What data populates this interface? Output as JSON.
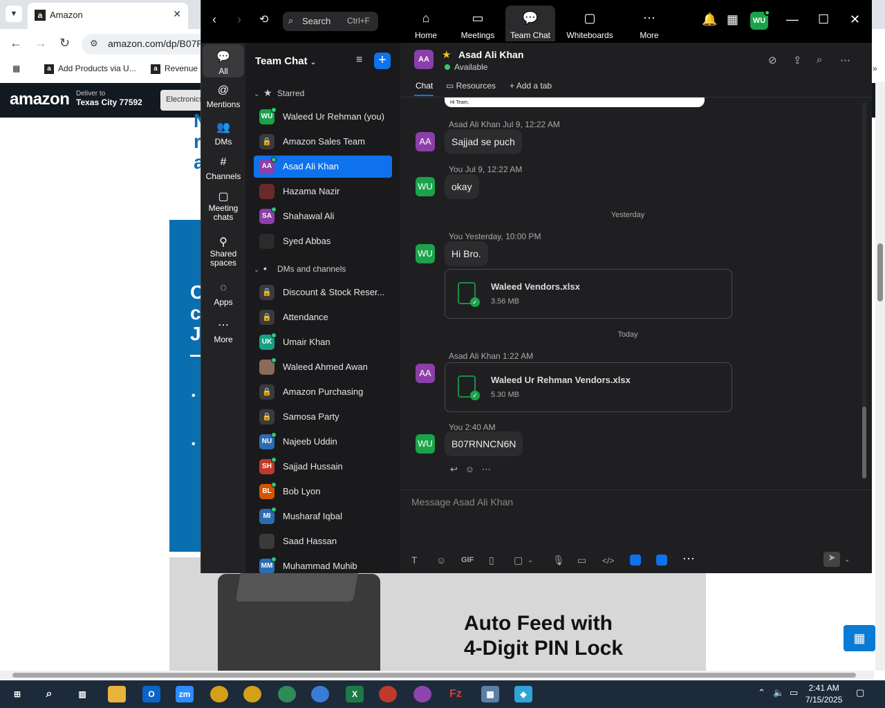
{
  "browser": {
    "tab_title": "Amazon",
    "url": "amazon.com/dp/B07R",
    "bookmarks": [
      "Add Products via U...",
      "Revenue"
    ],
    "amazon": {
      "logo": "amazon",
      "deliver_to": "Deliver to",
      "location": "Texas City 77592",
      "search_category": "Electronics"
    },
    "product_blurb_letters": [
      "N",
      "r",
      "a"
    ],
    "banner_letters": [
      "C",
      "c",
      "J",
      "—",
      "•",
      "•"
    ],
    "autofeed_line1": "Auto Feed with",
    "autofeed_line2": "4-Digit PIN Lock"
  },
  "zoom": {
    "search": {
      "label": "Search",
      "shortcut": "Ctrl+F"
    },
    "top_tabs": [
      {
        "label": "Home",
        "icon": "home-icon"
      },
      {
        "label": "Meetings",
        "icon": "video-icon"
      },
      {
        "label": "Team Chat",
        "icon": "chat-icon",
        "active": true
      },
      {
        "label": "Whiteboards",
        "icon": "whiteboard-icon"
      },
      {
        "label": "More",
        "icon": "more-icon"
      }
    ],
    "user_initials": "WU",
    "rail": [
      {
        "label": "All",
        "active": true
      },
      {
        "label": "Mentions"
      },
      {
        "label": "DMs"
      },
      {
        "label": "Channels"
      },
      {
        "label": "Meeting chats"
      },
      {
        "label": "Shared spaces"
      },
      {
        "label": "Apps"
      },
      {
        "label": "More"
      }
    ],
    "list": {
      "header": "Team Chat",
      "starred_label": "Starred",
      "starred": [
        {
          "initials": "WU",
          "name": "Waleed Ur Rehman (you)",
          "color": "#1aa34a",
          "online": true
        },
        {
          "initials": "🔒",
          "name": "Amazon Sales Team",
          "lock": true
        },
        {
          "initials": "AA",
          "name": "Asad Ali Khan",
          "color": "#8b3fa8",
          "online": true,
          "selected": true
        },
        {
          "initials": "",
          "name": "Hazama Nazir",
          "color": "#6b2a2a"
        },
        {
          "initials": "SA",
          "name": "Shahawal Ali",
          "color": "#8b3fa8",
          "online": true
        },
        {
          "initials": "",
          "name": "Syed Abbas",
          "color": "#2b2b2b"
        }
      ],
      "dms_label": "DMs and channels",
      "dms": [
        {
          "initials": "🔒",
          "name": "Discount & Stock Reser...",
          "lock": true
        },
        {
          "initials": "🔒",
          "name": "Attendance",
          "lock": true
        },
        {
          "initials": "UK",
          "name": "Umair Khan",
          "color": "#17a085",
          "online": true
        },
        {
          "initials": "",
          "name": "Waleed Ahmed Awan",
          "color": "#8a6a5a",
          "online": true
        },
        {
          "initials": "🔒",
          "name": "Amazon Purchasing",
          "lock": true
        },
        {
          "initials": "🔒",
          "name": "Samosa Party",
          "lock": true
        },
        {
          "initials": "NU",
          "name": "Najeeb Uddin",
          "color": "#2b6cb0",
          "online": true
        },
        {
          "initials": "SH",
          "name": "Sajjad Hussain",
          "color": "#c0392b",
          "online": true
        },
        {
          "initials": "BL",
          "name": "Bob Lyon",
          "color": "#d35400",
          "online": true
        },
        {
          "initials": "MI",
          "name": "Musharaf Iqbal",
          "color": "#2b6cb0",
          "online": true
        },
        {
          "initials": "",
          "name": "Saad Hassan",
          "color": "#3a3a3a"
        },
        {
          "initials": "MM",
          "name": "Muhammad Muhib",
          "color": "#2b6cb0",
          "online": true
        }
      ]
    },
    "chat": {
      "contact_initials": "AA",
      "contact_name": "Asad Ali Khan",
      "status": "Available",
      "tabs": [
        "Chat",
        "Resources",
        "Add a tab"
      ],
      "prev_card_text": "Hi Team,",
      "messages": {
        "m1_meta": "Asad Ali Khan Jul 9, 12:22 AM",
        "m1_text": "Sajjad se puch",
        "m2_meta": "You Jul 9, 12:22 AM",
        "m2_text": "okay",
        "day1": "Yesterday",
        "m3_meta": "You Yesterday, 10:00 PM",
        "m3_text": "Hi Bro.",
        "m3_file_name": "Waleed Vendors.xlsx",
        "m3_file_size": "3.56 MB",
        "day2": "Today",
        "m4_meta": "Asad Ali Khan 1:22 AM",
        "m4_file_name": "Waleed Ur Rehman Vendors.xlsx",
        "m4_file_size": "5.30 MB",
        "m5_meta": "You 2:40 AM",
        "m5_text": "B07RNNCN6N"
      },
      "composer_placeholder": "Message Asad Ali Khan"
    }
  },
  "taskbar": {
    "time": "2:41 AM",
    "date": "7/15/2025"
  }
}
